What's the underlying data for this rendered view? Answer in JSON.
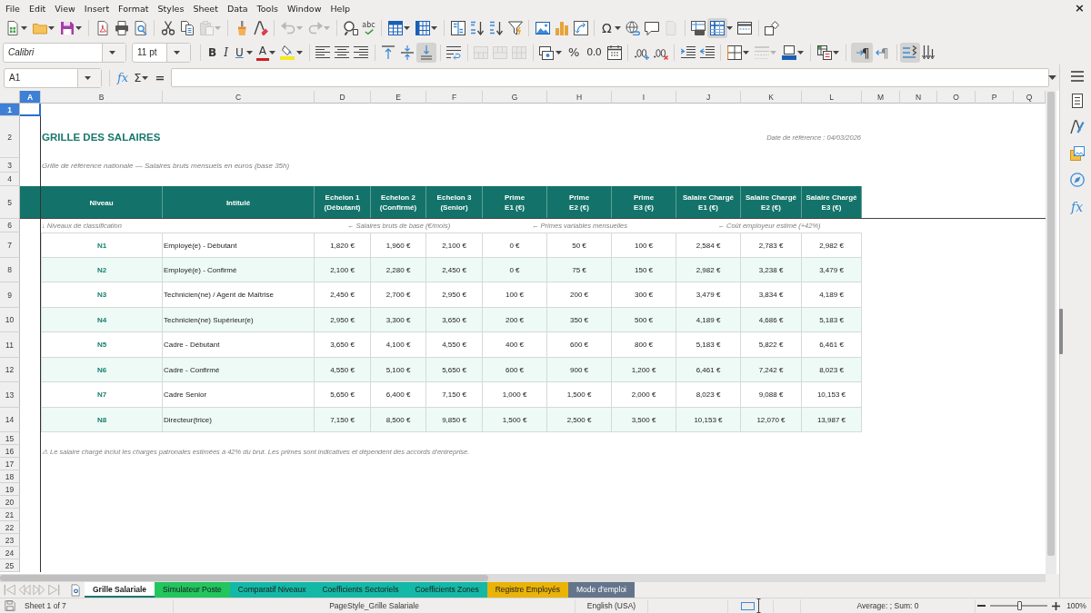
{
  "menu_bar": {
    "items": [
      "File",
      "Edit",
      "View",
      "Insert",
      "Format",
      "Styles",
      "Sheet",
      "Data",
      "Tools",
      "Window",
      "Help"
    ],
    "close_button": "×"
  },
  "standard_toolbar": {
    "paste": {
      "disabled": true
    },
    "undo": {
      "disabled": true
    },
    "redo": {
      "disabled": true
    },
    "spelling": "abc",
    "special_character": "Ω",
    "header_footer": {
      "disabled": true
    },
    "freeze_panes": {
      "pressed": true
    }
  },
  "formatting_toolbar": {
    "font_name": "Calibri",
    "font_size": "11 pt",
    "bold": "B",
    "italic": "I",
    "underline": "U",
    "font_color": "A",
    "align_bottom": {
      "pressed": true
    },
    "merge_buttons": {
      "disabled": true
    },
    "percent": "%",
    "number": "0.0",
    "border_style": {
      "disabled": true
    },
    "left_to_right": {
      "glyph": "¶",
      "pressed": true
    },
    "right_to_left": {
      "glyph": "¶",
      "pressed": false
    },
    "text_direction": {
      "pressed": true
    }
  },
  "formula_bar": {
    "name_box": "A1",
    "function_wizard": "fx",
    "sum": "Σ",
    "equals": "="
  },
  "sheet": {
    "columns": [
      {
        "label": "A",
        "selected": true
      },
      {
        "label": "B",
        "selected": false
      },
      {
        "label": "C",
        "selected": false
      },
      {
        "label": "D",
        "selected": false
      },
      {
        "label": "E",
        "selected": false
      },
      {
        "label": "F",
        "selected": false
      },
      {
        "label": "G",
        "selected": false
      },
      {
        "label": "H",
        "selected": false
      },
      {
        "label": "I",
        "selected": false
      },
      {
        "label": "J",
        "selected": false
      },
      {
        "label": "K",
        "selected": false
      },
      {
        "label": "L",
        "selected": false
      },
      {
        "label": "M",
        "selected": false
      },
      {
        "label": "N",
        "selected": false
      },
      {
        "label": "O",
        "selected": false
      },
      {
        "label": "P",
        "selected": false
      },
      {
        "label": "Q",
        "selected": false
      }
    ],
    "rows": [
      {
        "label": "1",
        "selected": true
      },
      {
        "label": "2",
        "selected": false
      },
      {
        "label": "3",
        "selected": false
      },
      {
        "label": "4",
        "selected": false
      },
      {
        "label": "5",
        "selected": false
      },
      {
        "label": "6",
        "selected": false
      },
      {
        "label": "7",
        "selected": false
      },
      {
        "label": "8",
        "selected": false
      },
      {
        "label": "9",
        "selected": false
      },
      {
        "label": "10",
        "selected": false
      },
      {
        "label": "11",
        "selected": false
      },
      {
        "label": "12",
        "selected": false
      },
      {
        "label": "13",
        "selected": false
      },
      {
        "label": "14",
        "selected": false
      },
      {
        "label": "15",
        "selected": false
      },
      {
        "label": "16",
        "selected": false
      },
      {
        "label": "17",
        "selected": false
      },
      {
        "label": "18",
        "selected": false
      },
      {
        "label": "19",
        "selected": false
      },
      {
        "label": "20",
        "selected": false
      },
      {
        "label": "21",
        "selected": false
      },
      {
        "label": "22",
        "selected": false
      },
      {
        "label": "23",
        "selected": false
      },
      {
        "label": "24",
        "selected": false
      },
      {
        "label": "25",
        "selected": false
      }
    ],
    "title": "GRILLE DES SALAIRES",
    "reference_date": "Date de référence : 04/03/2026",
    "subtitle": "Grille de référence nationale — Salaires bruts mensuels en euros (base 35h)",
    "table": {
      "columns": [
        "Niveau",
        "Intitulé",
        "Echelon 1\n(Débutant)",
        "Echelon 2\n(Confirmé)",
        "Echelon 3\n(Senior)",
        "Prime\nE1 (€)",
        "Prime\nE2 (€)",
        "Prime\nE3 (€)",
        "Salaire Chargé\nE1 (€)",
        "Salaire Chargé\nE2 (€)",
        "Salaire Chargé\nE3 (€)"
      ],
      "group_notes": [
        "↓ Niveaux de classification",
        "← Salaires bruts de base (€/mois)",
        "← Primes variables mensuelles",
        "← Coût employeur estimé (+42%)"
      ],
      "rows": [
        {
          "level": "N1",
          "title": "Employé(e) - Débutant",
          "values": [
            "1,820 €",
            "1,960 €",
            "2,100 €",
            "0 €",
            "50 €",
            "100 €",
            "2,584 €",
            "2,783 €",
            "2,982 €"
          ]
        },
        {
          "level": "N2",
          "title": "Employé(e) - Confirmé",
          "values": [
            "2,100 €",
            "2,280 €",
            "2,450 €",
            "0 €",
            "75 €",
            "150 €",
            "2,982 €",
            "3,238 €",
            "3,479 €"
          ]
        },
        {
          "level": "N3",
          "title": "Technicien(ne) / Agent de Maîtrise",
          "values": [
            "2,450 €",
            "2,700 €",
            "2,950 €",
            "100 €",
            "200 €",
            "300 €",
            "3,479 €",
            "3,834 €",
            "4,189 €"
          ]
        },
        {
          "level": "N4",
          "title": "Technicien(ne) Supérieur(e)",
          "values": [
            "2,950 €",
            "3,300 €",
            "3,650 €",
            "200 €",
            "350 €",
            "500 €",
            "4,189 €",
            "4,686 €",
            "5,183 €"
          ]
        },
        {
          "level": "N5",
          "title": "Cadre - Débutant",
          "values": [
            "3,650 €",
            "4,100 €",
            "4,550 €",
            "400 €",
            "600 €",
            "800 €",
            "5,183 €",
            "5,822 €",
            "6,461 €"
          ]
        },
        {
          "level": "N6",
          "title": "Cadre - Confirmé",
          "values": [
            "4,550 €",
            "5,100 €",
            "5,650 €",
            "600 €",
            "900 €",
            "1,200 €",
            "6,461 €",
            "7,242 €",
            "8,023 €"
          ]
        },
        {
          "level": "N7",
          "title": "Cadre Senior",
          "values": [
            "5,650 €",
            "6,400 €",
            "7,150 €",
            "1,000 €",
            "1,500 €",
            "2,000 €",
            "8,023 €",
            "9,088 €",
            "10,153 €"
          ]
        },
        {
          "level": "N8",
          "title": "Directeur(trice)",
          "values": [
            "7,150 €",
            "8,500 €",
            "9,850 €",
            "1,500 €",
            "2,500 €",
            "3,500 €",
            "10,153 €",
            "12,070 €",
            "13,987 €"
          ]
        }
      ]
    },
    "footnote": "⚠ Le salaire chargé inclut les charges patronales estimées à 42% du brut. Les primes sont indicatives et dépendent des accords d'entreprise."
  },
  "sheet_tabs": [
    {
      "label": "Grille Salariale",
      "selected": true,
      "color": "#0f766e"
    },
    {
      "label": "Simulateur Poste",
      "selected": false,
      "color": "#22c55e"
    },
    {
      "label": "Comparatif Niveaux",
      "selected": false,
      "color": "#14b8a6"
    },
    {
      "label": "Coefficients Sectoriels",
      "selected": false,
      "color": "#14b8a6"
    },
    {
      "label": "Coefficients Zones",
      "selected": false,
      "color": "#14b8a6"
    },
    {
      "label": "Registre Employés",
      "selected": false,
      "color": "#eab308"
    },
    {
      "label": "Mode d'emploi",
      "selected": false,
      "color": "#64748b"
    }
  ],
  "sidebar": {
    "functions_button": "fx"
  },
  "status_bar": {
    "sheet": "Sheet 1 of 7",
    "page_style": "PageStyle_Grille Salariale",
    "language": "English (USA)",
    "selection_summary": "Average: ; Sum: 0",
    "zoom": {
      "level": 0.5,
      "reading": "100%"
    }
  }
}
